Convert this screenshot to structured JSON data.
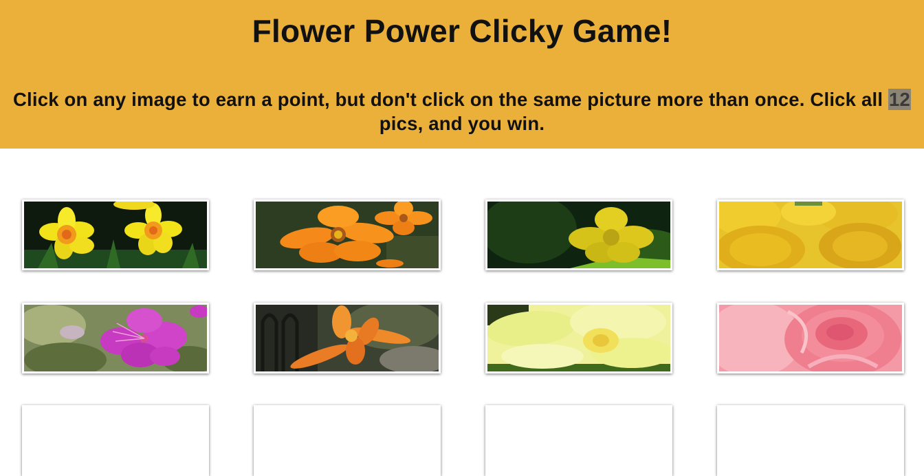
{
  "header": {
    "title": "Flower Power Clicky Game!",
    "instructions_before": "Click on any image to earn a point, but don't click on the same picture more than once. Click all",
    "total_pics": "12",
    "instructions_after": "pics, and you win.",
    "background_color": "#ebb03a"
  },
  "cards": [
    {
      "name": "daffodil-card",
      "flower": "yellow daffodils"
    },
    {
      "name": "orange-cosmos-card",
      "flower": "orange cosmos"
    },
    {
      "name": "buttercup-card",
      "flower": "yellow buttercup"
    },
    {
      "name": "marigold-card",
      "flower": "yellow marigolds"
    },
    {
      "name": "azalea-card",
      "flower": "magenta azalea"
    },
    {
      "name": "daylily-card",
      "flower": "orange daylily"
    },
    {
      "name": "pale-yellow-flower-card",
      "flower": "pale yellow flower"
    },
    {
      "name": "pink-rose-card",
      "flower": "pink rose"
    }
  ]
}
